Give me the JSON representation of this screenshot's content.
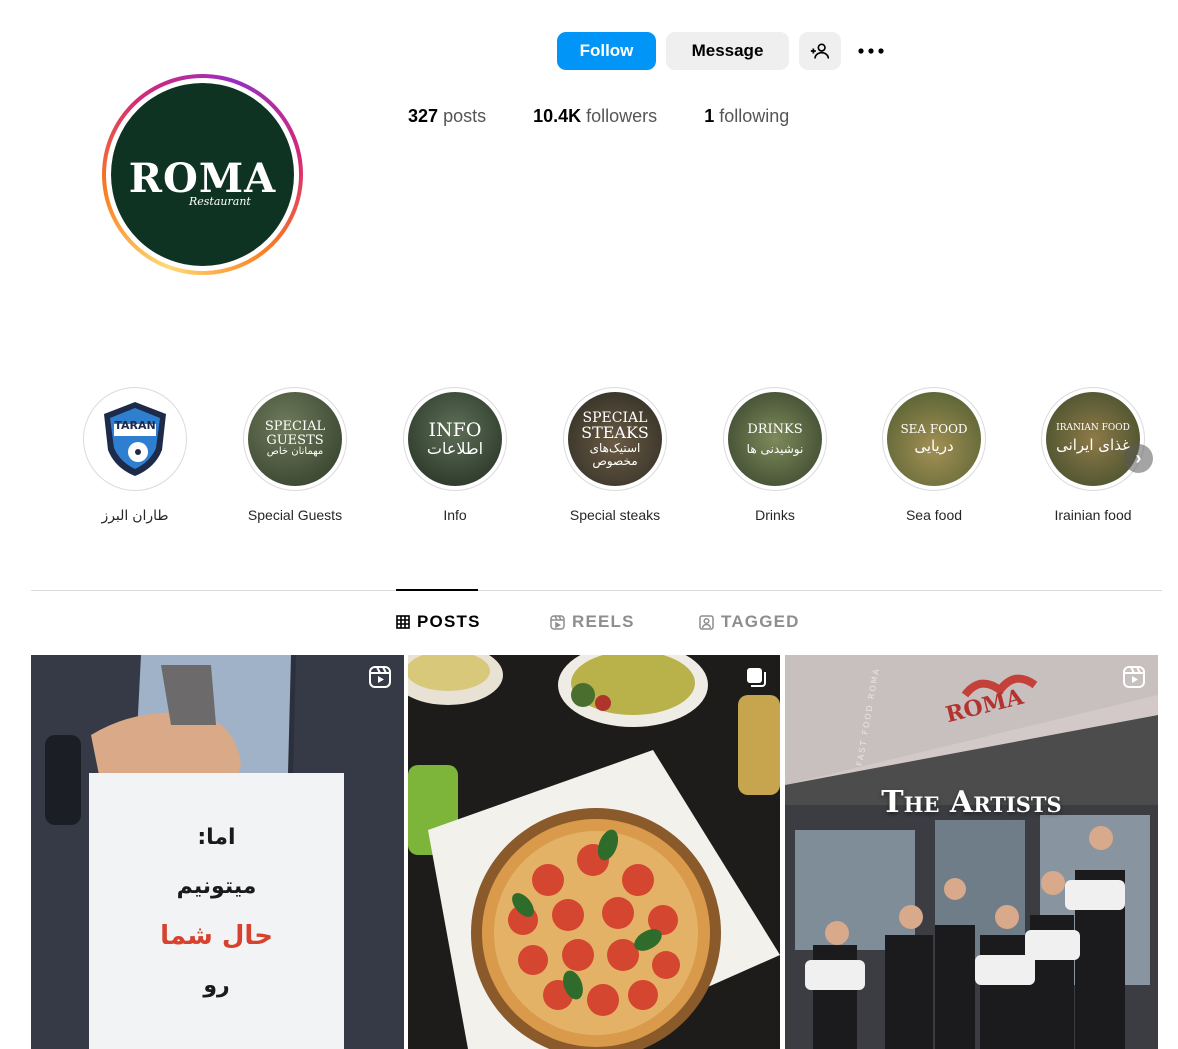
{
  "profile": {
    "logo_text": "ROMA",
    "logo_subtext": "Restaurant"
  },
  "actions": {
    "follow_label": "Follow",
    "message_label": "Message"
  },
  "stats": {
    "posts_count": "327",
    "posts_label": "posts",
    "followers_count": "10.4K",
    "followers_label": "followers",
    "following_count": "1",
    "following_label": "following"
  },
  "highlights": [
    {
      "label": "طاران البرز",
      "cover_text": [
        "TARAN"
      ]
    },
    {
      "label": "Special Guests",
      "cover_text": [
        "SPECIAL",
        "GUESTS",
        "مهمانان خاص"
      ]
    },
    {
      "label": "Info",
      "cover_text": [
        "INFO",
        "اطلاعات"
      ]
    },
    {
      "label": "Special steaks",
      "cover_text": [
        "SPECIAL",
        "STEAKS",
        "استیک‌های",
        "مخصوص"
      ]
    },
    {
      "label": "Drinks",
      "cover_text": [
        "DRINKS",
        "نوشیدنی ها"
      ]
    },
    {
      "label": "Sea food",
      "cover_text": [
        "SEA FOOD",
        "دریایی"
      ]
    },
    {
      "label": "Irainian food",
      "cover_text": [
        "IRANIAN FOOD",
        "غذای ایرانی"
      ]
    }
  ],
  "tabs": [
    {
      "label": "POSTS",
      "icon": "grid-icon",
      "active": true
    },
    {
      "label": "REELS",
      "icon": "reels-icon",
      "active": false
    },
    {
      "label": "TAGGED",
      "icon": "tagged-icon",
      "active": false
    }
  ],
  "posts": [
    {
      "type": "reel",
      "sign_lines": [
        "اما:",
        "میتونیم",
        "حال شما",
        "رو"
      ],
      "accent_color": "#d6422f"
    },
    {
      "type": "carousel"
    },
    {
      "type": "reel",
      "overlay_title": "The Artists",
      "sign_text": "ROMA",
      "facade_text": "FAST FOOD ROMA"
    }
  ],
  "colors": {
    "accent": "#0095f6",
    "logo_bg": "#0e3323"
  }
}
